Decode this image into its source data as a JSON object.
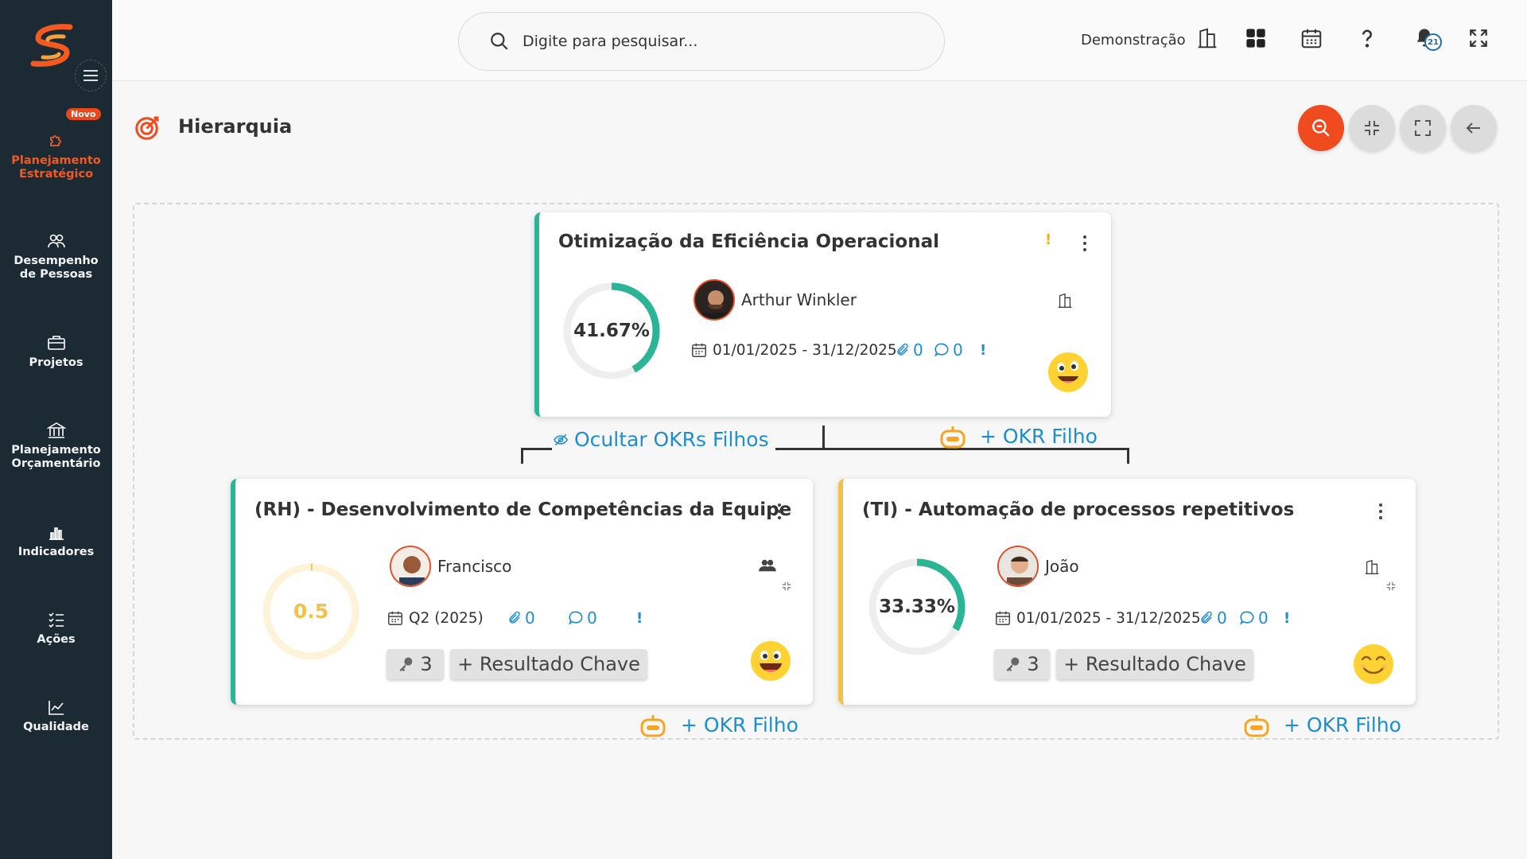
{
  "sidebar": {
    "badge_new": "Novo",
    "items": [
      {
        "label_l1": "Planejamento",
        "label_l2": "Estratégico",
        "icon": "puzzle-icon"
      },
      {
        "label_l1": "Desempenho",
        "label_l2": "de Pessoas",
        "icon": "people-icon"
      },
      {
        "label_l1": "Projetos",
        "label_l2": "",
        "icon": "briefcase-icon"
      },
      {
        "label_l1": "Planejamento",
        "label_l2": "Orçamentário",
        "icon": "bank-icon"
      },
      {
        "label_l1": "Indicadores",
        "label_l2": "",
        "icon": "bar-chart-icon"
      },
      {
        "label_l1": "Ações",
        "label_l2": "",
        "icon": "checklist-icon"
      },
      {
        "label_l1": "Qualidade",
        "label_l2": "",
        "icon": "line-chart-icon"
      }
    ]
  },
  "header": {
    "search_placeholder": "Digite para pesquisar...",
    "company": "Demonstração",
    "notifications_count": "21"
  },
  "page": {
    "title": "Hierarquia"
  },
  "colors": {
    "accent": "#f04a1f",
    "green": "#2bb594",
    "yellow": "#f3c04a",
    "blue": "#1d8ed0",
    "sidebar": "#1b2a33"
  },
  "root": {
    "title": "Otimização da Eficiência Operacional",
    "progress_label": "41.67%",
    "progress": 0.4167,
    "owner": "Arthur Winkler",
    "period": "01/01/2025 - 31/12/2025",
    "attachments": "0",
    "comments": "0",
    "hide_children": "Ocultar OKRs Filhos",
    "add_child": "+ OKR Filho"
  },
  "children": [
    {
      "title": "(RH) - Desenvolvimento de Competências da Equipe",
      "progress_label": "0.5",
      "progress": 0.005,
      "owner": "Francisco",
      "period": "Q2 (2025)",
      "attachments": "0",
      "comments": "0",
      "key_results": "3",
      "add_kr": "+ Resultado Chave",
      "add_child": "+ OKR Filho"
    },
    {
      "title": "(TI) - Automação de processos repetitivos",
      "progress_label": "33.33%",
      "progress": 0.3333,
      "owner": "João",
      "period": "01/01/2025 - 31/12/2025",
      "attachments": "0",
      "comments": "0",
      "key_results": "3",
      "add_kr": "+ Resultado Chave",
      "add_child": "+ OKR Filho"
    }
  ]
}
